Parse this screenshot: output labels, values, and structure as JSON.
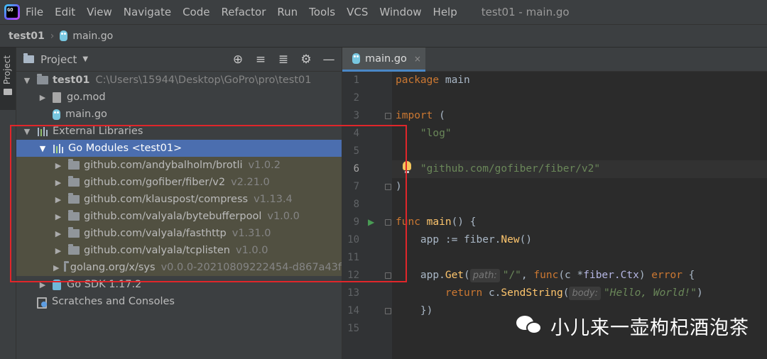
{
  "menu": {
    "items": [
      "File",
      "Edit",
      "View",
      "Navigate",
      "Code",
      "Refactor",
      "Run",
      "Tools",
      "VCS",
      "Window",
      "Help"
    ],
    "window_title": "test01 - main.go"
  },
  "breadcrumb": {
    "project": "test01",
    "file": "main.go",
    "separator": "›"
  },
  "toolstrip": {
    "label": "Project"
  },
  "project_panel": {
    "title": "Project",
    "caret": "▼",
    "actions": {
      "locate": "⊕",
      "expand": "≡",
      "collapse": "≣",
      "settings": "⚙",
      "hide": "—"
    },
    "tree": {
      "root": {
        "name": "test01",
        "path": "C:\\Users\\15944\\Desktop\\GoPro\\pro\\test01"
      },
      "go_mod": "go.mod",
      "main_go": "main.go",
      "external_libraries": "External Libraries",
      "go_modules": "Go Modules <test01>",
      "modules": [
        {
          "name": "github.com/andybalholm/brotli",
          "version": "v1.0.2"
        },
        {
          "name": "github.com/gofiber/fiber/v2",
          "version": "v2.21.0"
        },
        {
          "name": "github.com/klauspost/compress",
          "version": "v1.13.4"
        },
        {
          "name": "github.com/valyala/bytebufferpool",
          "version": "v1.0.0"
        },
        {
          "name": "github.com/valyala/fasthttp",
          "version": "v1.31.0"
        },
        {
          "name": "github.com/valyala/tcplisten",
          "version": "v1.0.0"
        },
        {
          "name": "golang.org/x/sys",
          "version": "v0.0.0-20210809222454-d867a43f"
        }
      ],
      "go_sdk": "Go SDK 1.17.2",
      "scratches": "Scratches and Consoles"
    },
    "highlight_color": "#e0262a"
  },
  "editor": {
    "tab": {
      "label": "main.go",
      "close": "×"
    },
    "line_numbers": [
      "1",
      "2",
      "3",
      "4",
      "5",
      "6",
      "7",
      "8",
      "9",
      "10",
      "11",
      "12",
      "13",
      "14",
      "15"
    ],
    "current_line": "6",
    "code": {
      "l1_kw": "package",
      "l1_name": " main",
      "l3_kw": "import",
      "l3_rest": " (",
      "l4": "    \"log\"",
      "l6": "    \"github.com/gofiber/fiber/v2\"",
      "l7": ")",
      "l9_kw": "func",
      "l9_fn": " main",
      "l9_rest": "() {",
      "l10_a": "    app := fiber.",
      "l10_fn": "New",
      "l10_b": "()",
      "l12_a": "    app.",
      "l12_fn": "Get",
      "l12_p": "(",
      "l12_hint1": "path:",
      "l12_str": "\"/\"",
      "l12_c": ", ",
      "l12_kw": "func",
      "l12_d": "(c *",
      "l12_typ": "fiber.Ctx",
      "l12_e": ") ",
      "l12_kw2": "error",
      "l12_f": " {",
      "l13_kw": "        return",
      "l13_a": " c.",
      "l13_fn": "SendString",
      "l13_p": "(",
      "l13_hint": "body:",
      "l13_str": "\"Hello, World!\"",
      "l13_b": ")",
      "l14": "    })"
    },
    "colors": {
      "keyword": "#cc7832",
      "string": "#6a8759",
      "function": "#ffc66d",
      "plain": "#a9b7c6"
    }
  },
  "watermark": {
    "text": "小儿来一壶枸杞酒泡茶"
  }
}
